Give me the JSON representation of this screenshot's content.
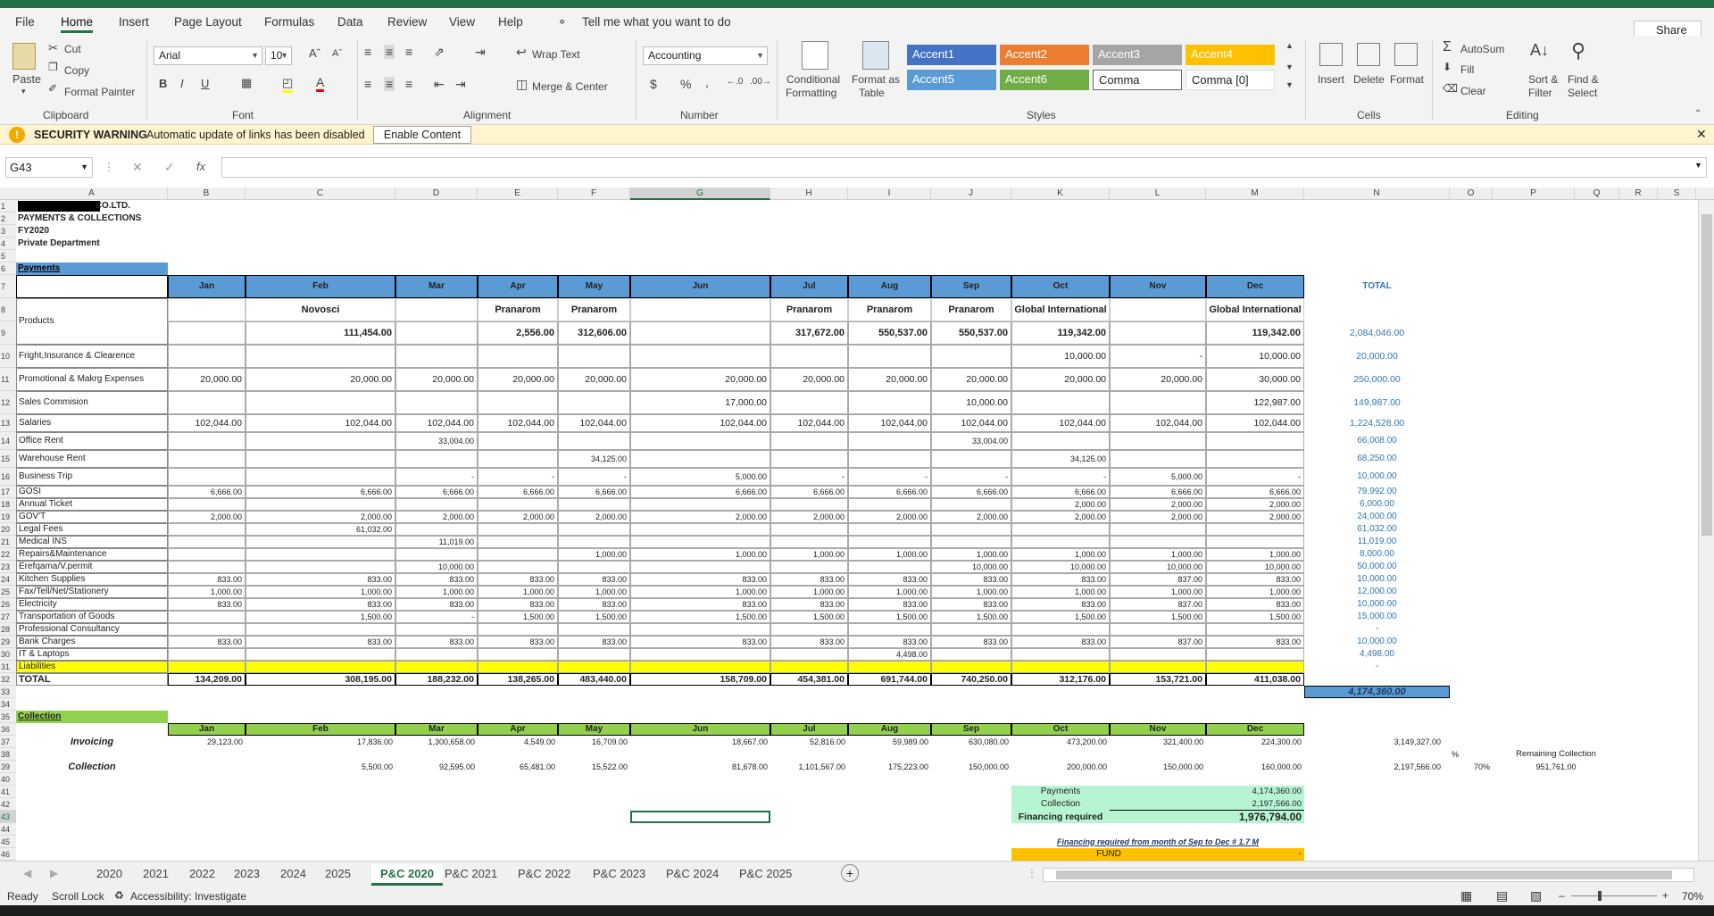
{
  "menu": {
    "tabs": [
      "File",
      "Home",
      "Insert",
      "Page Layout",
      "Formulas",
      "Data",
      "Review",
      "View",
      "Help"
    ],
    "active": "Home",
    "tell_me": "Tell me what you want to do",
    "share": "Share"
  },
  "ribbon": {
    "clipboard": {
      "paste": "Paste",
      "cut": "Cut",
      "copy": "Copy",
      "format_painter": "Format Painter",
      "label": "Clipboard"
    },
    "font": {
      "name": "Arial",
      "size": "10",
      "label": "Font"
    },
    "alignment": {
      "wrap": "Wrap Text",
      "merge": "Merge & Center",
      "label": "Alignment"
    },
    "number": {
      "format": "Accounting",
      "label": "Number",
      "currency": "$",
      "percent": "%",
      "comma": ","
    },
    "styles": {
      "cond": "Conditional",
      "cond2": "Formatting",
      "format_as": "Format as",
      "table": "Table",
      "label": "Styles",
      "cells": [
        {
          "name": "Accent1",
          "color": "#4472c4"
        },
        {
          "name": "Accent2",
          "color": "#ed7d31"
        },
        {
          "name": "Accent3",
          "color": "#a5a5a5"
        },
        {
          "name": "Accent4",
          "color": "#ffc000"
        },
        {
          "name": "Accent5",
          "color": "#5b9bd5"
        },
        {
          "name": "Accent6",
          "color": "#70ad47"
        },
        {
          "name": "Comma",
          "color": "#ffffff"
        },
        {
          "name": "Comma [0]",
          "color": "#ffffff"
        }
      ]
    },
    "cells": {
      "insert": "Insert",
      "delete": "Delete",
      "format": "Format",
      "label": "Cells"
    },
    "editing": {
      "autosum": "AutoSum",
      "fill": "Fill",
      "clear": "Clear",
      "sort": "Sort &",
      "sort2": "Filter",
      "find": "Find &",
      "find2": "Select",
      "label": "Editing"
    }
  },
  "security": {
    "title": "SECURITY WARNING",
    "message": "Automatic update of links has been disabled",
    "button": "Enable Content"
  },
  "formula": {
    "namebox": "G43",
    "fx": "fx"
  },
  "columns": [
    "A",
    "B",
    "C",
    "D",
    "E",
    "F",
    "G",
    "H",
    "I",
    "J",
    "K",
    "L",
    "M",
    "N",
    "O",
    "P",
    "Q",
    "R",
    "S"
  ],
  "sheet": {
    "company": "CO.LTD.",
    "title": "PAYMENTS & COLLECTIONS",
    "fy": "FY2020",
    "dept": "Private Department",
    "payments_label": "Payments",
    "collection_label": "Collection",
    "months": [
      "Jan",
      "Feb",
      "Mar",
      "Apr",
      "May",
      "Jun",
      "Jul",
      "Aug",
      "Sep",
      "Oct",
      "Nov",
      "Dec"
    ],
    "total_label": "TOTAL",
    "supplier": [
      "",
      "Novosci",
      "",
      "Pranarom",
      "Pranarom",
      "",
      "Pranarom",
      "Pranarom",
      "Pranarom",
      "Global International",
      "",
      "Global International"
    ],
    "rows": [
      {
        "r": 9,
        "label": "Products",
        "vals": [
          "",
          "111,454.00",
          "",
          "2,556.00",
          "312,606.00",
          "",
          "317,672.00",
          "550,537.00",
          "550,537.00",
          "119,342.00",
          "",
          "119,342.00"
        ],
        "total": "2,084,046.00",
        "bold": true
      },
      {
        "r": 10,
        "label": "Fright,Insurance & Clearence",
        "vals": [
          "",
          "",
          "",
          "",
          "",
          "",
          "",
          "",
          "",
          "10,000.00",
          "-",
          "10,000.00"
        ],
        "total": "20,000.00"
      },
      {
        "r": 11,
        "label": "Promotional & Makrg Expenses",
        "vals": [
          "20,000.00",
          "20,000.00",
          "20,000.00",
          "20,000.00",
          "20,000.00",
          "20,000.00",
          "20,000.00",
          "20,000.00",
          "20,000.00",
          "20,000.00",
          "20,000.00",
          "30,000.00"
        ],
        "total": "250,000.00"
      },
      {
        "r": 12,
        "label": "Sales Commision",
        "vals": [
          "",
          "",
          "",
          "",
          "",
          "17,000.00",
          "",
          "",
          "10,000.00",
          "",
          "",
          "122,987.00"
        ],
        "total": "149,987.00"
      },
      {
        "r": 13,
        "label": "Salaries",
        "vals": [
          "102,044.00",
          "102,044.00",
          "102,044.00",
          "102,044.00",
          "102,044.00",
          "102,044.00",
          "102,044.00",
          "102,044.00",
          "102,044.00",
          "102,044.00",
          "102,044.00",
          "102,044.00"
        ],
        "total": "1,224,528.00"
      },
      {
        "r": 14,
        "label": "Office Rent",
        "vals": [
          "",
          "",
          "33,004.00",
          "",
          "",
          "",
          "",
          "",
          "33,004.00",
          "",
          "",
          ""
        ],
        "total": "66,008.00"
      },
      {
        "r": 15,
        "label": "Warehouse Rent",
        "vals": [
          "",
          "",
          "",
          "",
          "34,125.00",
          "",
          "",
          "",
          "",
          "34,125.00",
          "",
          ""
        ],
        "total": "68,250.00"
      },
      {
        "r": 16,
        "label": "Business Trip",
        "vals": [
          "",
          "",
          "-",
          "-",
          "-",
          "5,000.00",
          "-",
          "-",
          "-",
          "-",
          "5,000.00",
          "-"
        ],
        "total": "10,000.00"
      },
      {
        "r": 17,
        "label": "GOSI",
        "vals": [
          "6,666.00",
          "6,666.00",
          "6,666.00",
          "6,666.00",
          "6,666.00",
          "6,666.00",
          "6,666.00",
          "6,666.00",
          "6,666.00",
          "6,666.00",
          "6,666.00",
          "6,666.00"
        ],
        "total": "79,992.00"
      },
      {
        "r": 18,
        "label": "Annual Ticket",
        "vals": [
          "",
          "",
          "",
          "",
          "",
          "",
          "",
          "",
          "",
          "2,000.00",
          "2,000.00",
          "2,000.00"
        ],
        "total": "6,000.00"
      },
      {
        "r": 19,
        "label": "GOV'T",
        "vals": [
          "2,000.00",
          "2,000.00",
          "2,000.00",
          "2,000.00",
          "2,000.00",
          "2,000.00",
          "2,000.00",
          "2,000.00",
          "2,000.00",
          "2,000.00",
          "2,000.00",
          "2,000.00"
        ],
        "total": "24,000.00"
      },
      {
        "r": 20,
        "label": "Legal Fees",
        "vals": [
          "",
          "61,032.00",
          "",
          "",
          "",
          "",
          "",
          "",
          "",
          "",
          "",
          ""
        ],
        "total": "61,032.00"
      },
      {
        "r": 21,
        "label": "Medical INS",
        "vals": [
          "",
          "",
          "11,019.00",
          "",
          "",
          "",
          "",
          "",
          "",
          "",
          "",
          ""
        ],
        "total": "11,019.00"
      },
      {
        "r": 22,
        "label": "Repairs&Maintenance",
        "vals": [
          "",
          "",
          "",
          "",
          "1,000.00",
          "1,000.00",
          "1,000.00",
          "1,000.00",
          "1,000.00",
          "1,000.00",
          "1,000.00",
          "1,000.00"
        ],
        "total": "8,000.00"
      },
      {
        "r": 23,
        "label": "Erefqama/V.permit",
        "vals": [
          "",
          "",
          "10,000.00",
          "",
          "",
          "",
          "",
          "",
          "10,000.00",
          "10,000.00",
          "10,000.00",
          "10,000.00"
        ],
        "total": "50,000.00"
      },
      {
        "r": 24,
        "label": "Kitchen Supplies",
        "vals": [
          "833.00",
          "833.00",
          "833.00",
          "833.00",
          "833.00",
          "833.00",
          "833.00",
          "833.00",
          "833.00",
          "833.00",
          "837.00",
          "833.00"
        ],
        "total": "10,000.00"
      },
      {
        "r": 25,
        "label": "Fax/Tell/Net/Stationery",
        "vals": [
          "1,000.00",
          "1,000.00",
          "1,000.00",
          "1,000.00",
          "1,000.00",
          "1,000.00",
          "1,000.00",
          "1,000.00",
          "1,000.00",
          "1,000.00",
          "1,000.00",
          "1,000.00"
        ],
        "total": "12,000.00"
      },
      {
        "r": 26,
        "label": "Electricity",
        "vals": [
          "833.00",
          "833.00",
          "833.00",
          "833.00",
          "833.00",
          "833.00",
          "833.00",
          "833.00",
          "833.00",
          "833.00",
          "837.00",
          "833.00"
        ],
        "total": "10,000.00"
      },
      {
        "r": 27,
        "label": "Transportation of Goods",
        "vals": [
          "",
          "1,500.00",
          "-",
          "1,500.00",
          "1,500.00",
          "1,500.00",
          "1,500.00",
          "1,500.00",
          "1,500.00",
          "1,500.00",
          "1,500.00",
          "1,500.00"
        ],
        "total": "15,000.00"
      },
      {
        "r": 28,
        "label": "Professional Consultancy",
        "vals": [
          "",
          "",
          "",
          "",
          "",
          "",
          "",
          "",
          "",
          "",
          "",
          ""
        ],
        "total": "-"
      },
      {
        "r": 29,
        "label": "Bank Charges",
        "vals": [
          "833.00",
          "833.00",
          "833.00",
          "833.00",
          "833.00",
          "833.00",
          "833.00",
          "833.00",
          "833.00",
          "833.00",
          "837.00",
          "833.00"
        ],
        "total": "10,000.00"
      },
      {
        "r": 30,
        "label": "IT & Laptops",
        "vals": [
          "",
          "",
          "",
          "",
          "",
          "",
          "",
          "4,498.00",
          "",
          "",
          "",
          ""
        ],
        "total": "4,498.00"
      },
      {
        "r": 31,
        "label": "Liabilities",
        "vals": [
          "",
          "",
          "",
          "",
          "",
          "",
          "",
          "",
          "",
          "",
          "",
          ""
        ],
        "total": "-"
      },
      {
        "r": 32,
        "label": "TOTAL",
        "vals": [
          "134,209.00",
          "308,195.00",
          "188,232.00",
          "138,265.00",
          "483,440.00",
          "158,709.00",
          "454,381.00",
          "691,744.00",
          "740,250.00",
          "312,176.00",
          "153,721.00",
          "411,038.00"
        ],
        "total": "",
        "bold": true
      }
    ],
    "grand_total": "4,174,360.00",
    "invoicing": {
      "label": "Invoicing",
      "vals": [
        "29,123.00",
        "17,836.00",
        "1,300,658.00",
        "4,549.00",
        "16,709.00",
        "18,667.00",
        "52,816.00",
        "59,989.00",
        "630,080.00",
        "473,200.00",
        "321,400.00",
        "224,300.00"
      ],
      "total": "3,149,327.00"
    },
    "collection": {
      "label": "Collection",
      "vals": [
        "",
        "5,500.00",
        "92,595.00",
        "65,481.00",
        "15,522.00",
        "81,678.00",
        "1,101,567.00",
        "175,223.00",
        "150,000.00",
        "200,000.00",
        "150,000.00",
        "160,000.00"
      ],
      "total": "2,197,566.00"
    },
    "pct_sign": "%",
    "pct": "70%",
    "remaining_label": "Remaining Collection",
    "remaining": "951,761.00",
    "summary": {
      "payments_label": "Payments",
      "payments": "4,174,360.00",
      "collection_label": "Collection",
      "collection": "2,197,566.00",
      "fin_label": "Financing required",
      "fin": "1,976,794.00"
    },
    "note": "Financing required from month of Sep to Dec # 1.7 M",
    "fund_label": "FUND",
    "fund_val": "-"
  },
  "sheet_tabs": [
    "2020",
    "2021",
    "2022",
    "2023",
    "2024",
    "2025",
    "P&C 2020",
    "P&C 2021",
    "P&C 2022",
    "P&C 2023",
    "P&C 2024",
    "P&C 2025"
  ],
  "active_tab": "P&C 2020",
  "status": {
    "ready": "Ready",
    "scroll": "Scroll Lock",
    "accessibility": "Accessibility: Investigate",
    "zoom": "70%"
  }
}
